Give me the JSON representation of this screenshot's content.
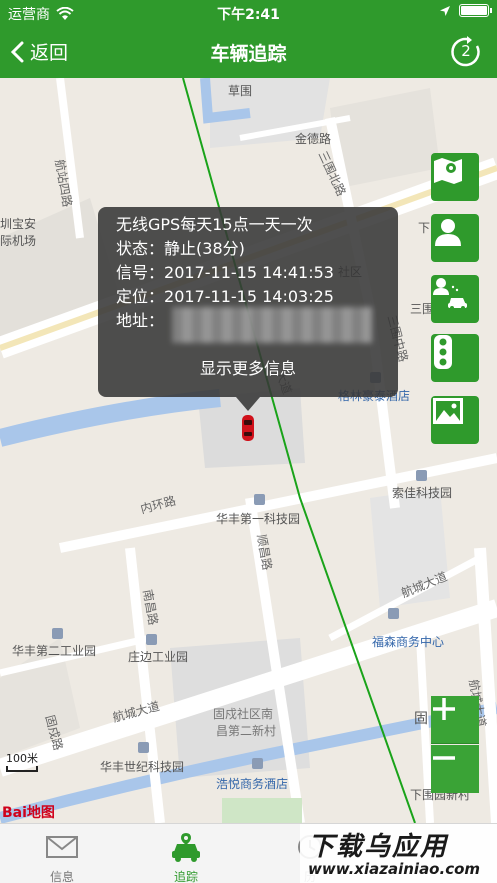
{
  "status_bar": {
    "carrier": "运营商",
    "time": "下午2:41"
  },
  "nav": {
    "back_label": "返回",
    "title": "车辆追踪",
    "refresh_count": "2"
  },
  "popup": {
    "line1": "无线GPS每天15点一天一次",
    "status_label": "状态：",
    "status_value": "静止(38分)",
    "signal_label": "信号：",
    "signal_value": "2017-11-15 14:41:53",
    "locate_label": "定位：",
    "locate_value": "2017-11-15 14:03:25",
    "address_label": "地址：",
    "more_label": "显示更多信息"
  },
  "map_labels": {
    "caowei": "草围",
    "jindelu": "金德路",
    "sanweibeilu": "三围北路",
    "hangzhansilu": "航站四路",
    "baoan_airport_1": "圳宝安",
    "baoan_airport_2": "际机场",
    "xia": "下",
    "shequ": "社区",
    "sanwei": "三围",
    "sanweizhonglu": "三围中路",
    "dadao": "大道",
    "gelinhaotai": "格林豪泰酒店",
    "neihuanlu": "内环路",
    "huafeng_first": "华丰第一科技园",
    "suojia": "索佳科技园",
    "shunchanglu": "顺昌路",
    "hangchengdadao_right": "航城大道",
    "nanchanglu": "南昌路",
    "fusen": "福森商务中心",
    "huafeng_second": "华丰第二工业园",
    "zhuangbian": "庄边工业园",
    "gushu_1": "固戍社区南",
    "gushu_2": "昌第二新村",
    "gu": "固",
    "hangchengdadao_left": "航城大道",
    "gushulu": "固戍路",
    "huafeng_century": "华丰世纪科技园",
    "haoyue": "浩悦商务酒店",
    "xiaweiyuan": "下围园新村",
    "right_road": "航城大道"
  },
  "scale_label": "100米",
  "baidu_logo": "Bai地图",
  "tabs": [
    {
      "label": "信息",
      "icon": "mail-icon"
    },
    {
      "label": "追踪",
      "icon": "car-track-icon"
    },
    {
      "label": "历",
      "icon": "history-icon"
    }
  ],
  "watermark": {
    "main": "下载乌应用",
    "sub": "www.xiazainiao.com"
  },
  "colors": {
    "brand_green": "#2f9a2c",
    "popup_bg": "#373737",
    "route_green": "#1aa31a"
  }
}
